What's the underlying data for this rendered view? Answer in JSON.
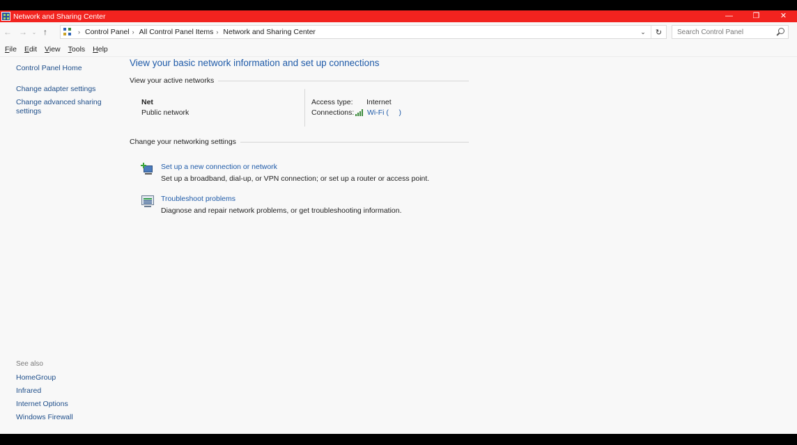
{
  "window": {
    "title": "Network and Sharing Center",
    "controls": {
      "minimize": "—",
      "restore": "❐",
      "close": "✕"
    }
  },
  "address": {
    "back_icon": "←",
    "forward_icon": "→",
    "recent_icon": "⌄",
    "up_icon": "↑",
    "breadcrumbs": [
      "Control Panel",
      "All Control Panel Items",
      "Network and Sharing Center"
    ],
    "separator": "›",
    "dropdown_icon": "⌄",
    "refresh_icon": "↻",
    "search_placeholder": "Search Control Panel"
  },
  "menu": [
    {
      "mnemonic": "F",
      "rest": "ile"
    },
    {
      "mnemonic": "E",
      "rest": "dit"
    },
    {
      "mnemonic": "V",
      "rest": "iew"
    },
    {
      "mnemonic": "T",
      "rest": "ools"
    },
    {
      "mnemonic": "H",
      "rest": "elp"
    }
  ],
  "leftnav": {
    "home": "Control Panel Home",
    "adapter": "Change adapter settings",
    "advanced": "Change advanced sharing settings"
  },
  "seealso": {
    "title": "See also",
    "links": [
      "HomeGroup",
      "Infrared",
      "Internet Options",
      "Windows Firewall"
    ]
  },
  "main": {
    "title": "View your basic network information and set up connections",
    "active_header": "View your active networks",
    "network": {
      "name": "Net",
      "type": "Public network",
      "access_label": "Access type:",
      "access_value": "Internet",
      "connections_label": "Connections:",
      "connection_value": "Wi-Fi (     )"
    },
    "settings_header": "Change your networking settings",
    "tasks": [
      {
        "link": "Set up a new connection or network",
        "desc": "Set up a broadband, dial-up, or VPN connection; or set up a router or access point."
      },
      {
        "link": "Troubleshoot problems",
        "desc": "Diagnose and repair network problems, or get troubleshooting information."
      }
    ]
  },
  "colors": {
    "titlebar": "#f2231f",
    "link": "#1e5aa8",
    "window_bg": "#f8f8f8"
  }
}
